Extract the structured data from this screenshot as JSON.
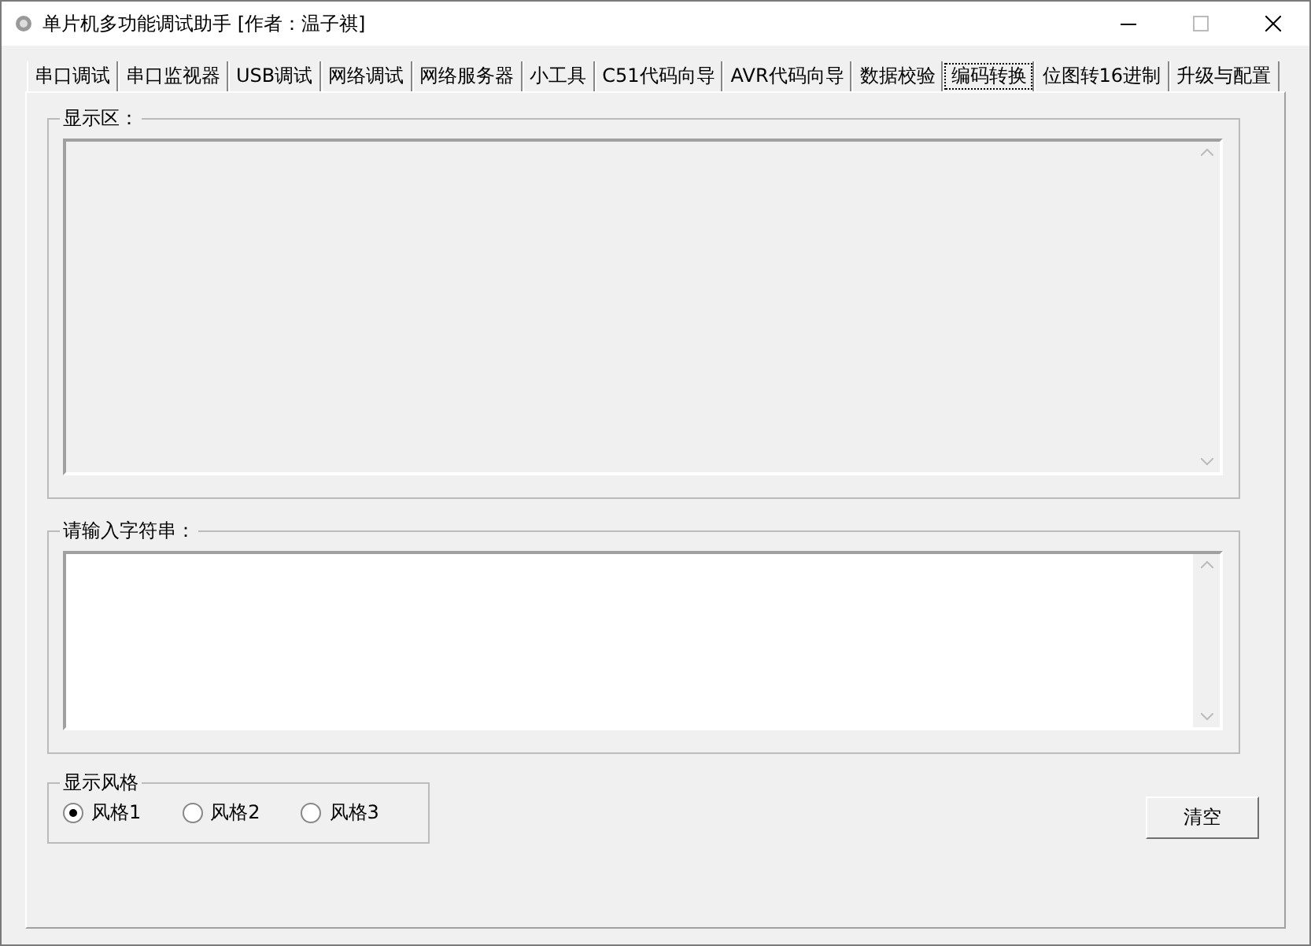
{
  "window": {
    "title": "单片机多功能调试助手 [作者：温子祺]"
  },
  "tabs": [
    {
      "label": "串口调试",
      "selected": false
    },
    {
      "label": "串口监视器",
      "selected": false
    },
    {
      "label": "USB调试",
      "selected": false
    },
    {
      "label": "网络调试",
      "selected": false
    },
    {
      "label": "网络服务器",
      "selected": false
    },
    {
      "label": "小工具",
      "selected": false
    },
    {
      "label": "C51代码向导",
      "selected": false
    },
    {
      "label": "AVR代码向导",
      "selected": false
    },
    {
      "label": "数据校验",
      "selected": false
    },
    {
      "label": "编码转换",
      "selected": true
    },
    {
      "label": "位图转16进制",
      "selected": false
    },
    {
      "label": "升级与配置",
      "selected": false
    }
  ],
  "display_group": {
    "label": "显示区："
  },
  "input_group": {
    "label": "请输入字符串："
  },
  "style_group": {
    "label": "显示风格",
    "options": [
      {
        "label": "风格1",
        "selected": true
      },
      {
        "label": "风格2",
        "selected": false
      },
      {
        "label": "风格3",
        "selected": false
      }
    ]
  },
  "clear_button": {
    "label": "清空"
  }
}
